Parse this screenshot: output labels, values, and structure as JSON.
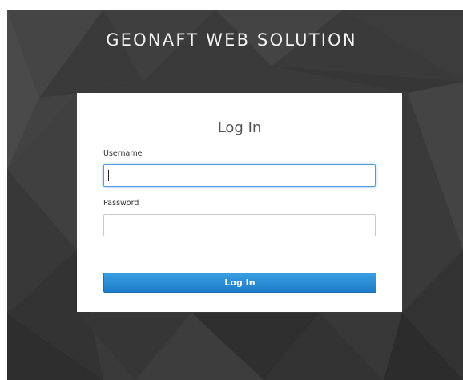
{
  "brand": {
    "title": "GEONAFT WEB SOLUTION"
  },
  "login": {
    "heading": "Log In",
    "username_label": "Username",
    "username_value": "",
    "password_label": "Password",
    "password_value": "",
    "submit_label": "Log In"
  },
  "colors": {
    "background": "#3a3a3a",
    "card": "#ffffff",
    "button": "#2186d1",
    "focus_border": "#4a9be0"
  }
}
